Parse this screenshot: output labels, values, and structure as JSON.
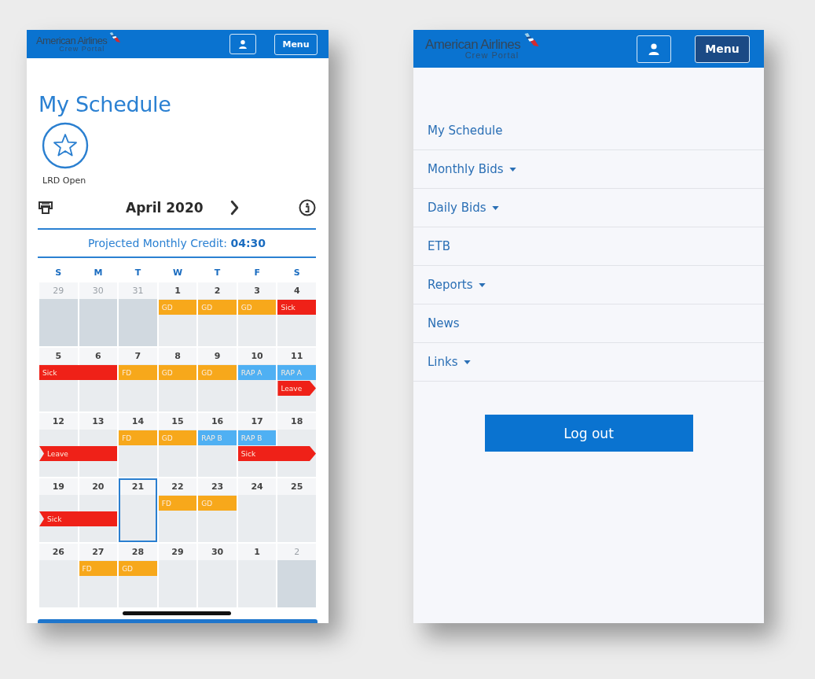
{
  "schedule_screen": {
    "header": {
      "logo_name": "American Airlines",
      "logo_subtitle": "Crew Portal",
      "menu_button": {
        "label": "Menu",
        "open": false
      }
    },
    "title": "My Schedule",
    "badge": {
      "label": "LRD Open"
    },
    "month": "April 2020",
    "credit": {
      "label": "Projected Monthly Credit:",
      "value": "04:30"
    },
    "weekdays": [
      "S",
      "M",
      "T",
      "W",
      "T",
      "F",
      "S"
    ],
    "weeks": [
      {
        "days": [
          {
            "label": "29",
            "outside": true,
            "selected": false
          },
          {
            "label": "30",
            "outside": true,
            "selected": false
          },
          {
            "label": "31",
            "outside": true,
            "selected": false
          },
          {
            "label": "1",
            "outside": false,
            "selected": false,
            "upper": {
              "kind": "start",
              "label": "GD",
              "color": "#f7a81b",
              "continues_before": false,
              "continues_after": false
            }
          },
          {
            "label": "2",
            "outside": false,
            "selected": false,
            "upper": {
              "kind": "start",
              "label": "GD",
              "color": "#f7a81b",
              "continues_before": false,
              "continues_after": false
            }
          },
          {
            "label": "3",
            "outside": false,
            "selected": false,
            "upper": {
              "kind": "start",
              "label": "GD",
              "color": "#f7a81b",
              "continues_before": false,
              "continues_after": false
            }
          },
          {
            "label": "4",
            "outside": false,
            "selected": false,
            "upper": {
              "kind": "start",
              "label": "Sick",
              "color": "#ef2118",
              "continues_before": false,
              "continues_after": false
            }
          }
        ]
      },
      {
        "days": [
          {
            "label": "5",
            "outside": false,
            "selected": false,
            "upper": {
              "kind": "start",
              "label": "Sick",
              "color": "#ef2118",
              "continues_before": false,
              "continues_after": false
            }
          },
          {
            "label": "6",
            "outside": false,
            "selected": false,
            "upper": {
              "kind": "continued"
            }
          },
          {
            "label": "7",
            "outside": false,
            "selected": false,
            "upper": {
              "kind": "start",
              "label": "FD",
              "color": "#f7a81b",
              "continues_before": false,
              "continues_after": false
            }
          },
          {
            "label": "8",
            "outside": false,
            "selected": false,
            "upper": {
              "kind": "start",
              "label": "GD",
              "color": "#f7a81b",
              "continues_before": false,
              "continues_after": false
            }
          },
          {
            "label": "9",
            "outside": false,
            "selected": false,
            "upper": {
              "kind": "start",
              "label": "GD",
              "color": "#f7a81b",
              "continues_before": false,
              "continues_after": false
            }
          },
          {
            "label": "10",
            "outside": false,
            "selected": false,
            "upper": {
              "kind": "start",
              "label": "RAP A",
              "color": "#4fb0f3",
              "continues_before": false,
              "continues_after": false
            }
          },
          {
            "label": "11",
            "outside": false,
            "selected": false,
            "upper": {
              "kind": "start",
              "label": "RAP A",
              "color": "#4fb0f3",
              "continues_before": false,
              "continues_after": false
            },
            "lower": {
              "kind": "start",
              "label": "Leave",
              "color": "#ef2118",
              "continues_before": false,
              "continues_after": true
            }
          }
        ]
      },
      {
        "days": [
          {
            "label": "12",
            "outside": false,
            "selected": false,
            "lower": {
              "kind": "start",
              "label": "Leave",
              "color": "#ef2118",
              "continues_before": true,
              "continues_after": false
            }
          },
          {
            "label": "13",
            "outside": false,
            "selected": false,
            "lower": {
              "kind": "continued"
            }
          },
          {
            "label": "14",
            "outside": false,
            "selected": false,
            "upper": {
              "kind": "start",
              "label": "FD",
              "color": "#f7a81b",
              "continues_before": false,
              "continues_after": false
            }
          },
          {
            "label": "15",
            "outside": false,
            "selected": false,
            "upper": {
              "kind": "start",
              "label": "GD",
              "color": "#f7a81b",
              "continues_before": false,
              "continues_after": false
            }
          },
          {
            "label": "16",
            "outside": false,
            "selected": false,
            "upper": {
              "kind": "start",
              "label": "RAP B",
              "color": "#4fb0f3",
              "continues_before": false,
              "continues_after": false
            }
          },
          {
            "label": "17",
            "outside": false,
            "selected": false,
            "upper": {
              "kind": "start",
              "label": "RAP B",
              "color": "#4fb0f3",
              "continues_before": false,
              "continues_after": false
            },
            "lower": {
              "kind": "start",
              "label": "Sick",
              "color": "#ef2118",
              "continues_before": false,
              "continues_after": true
            }
          },
          {
            "label": "18",
            "outside": false,
            "selected": false,
            "lower": {
              "kind": "continued"
            }
          }
        ]
      },
      {
        "days": [
          {
            "label": "19",
            "outside": false,
            "selected": false,
            "lower": {
              "kind": "start",
              "label": "Sick",
              "color": "#ef2118",
              "continues_before": true,
              "continues_after": false
            }
          },
          {
            "label": "20",
            "outside": false,
            "selected": false,
            "lower": {
              "kind": "continued"
            }
          },
          {
            "label": "21",
            "outside": false,
            "selected": true
          },
          {
            "label": "22",
            "outside": false,
            "selected": false,
            "upper": {
              "kind": "start",
              "label": "FD",
              "color": "#f7a81b",
              "continues_before": false,
              "continues_after": false
            }
          },
          {
            "label": "23",
            "outside": false,
            "selected": false,
            "upper": {
              "kind": "start",
              "label": "GD",
              "color": "#f7a81b",
              "continues_before": false,
              "continues_after": false
            }
          },
          {
            "label": "24",
            "outside": false,
            "selected": false
          },
          {
            "label": "25",
            "outside": false,
            "selected": false
          }
        ]
      },
      {
        "days": [
          {
            "label": "26",
            "outside": false,
            "selected": false
          },
          {
            "label": "27",
            "outside": false,
            "selected": false,
            "upper": {
              "kind": "start",
              "label": "FD",
              "color": "#f7a81b",
              "continues_before": false,
              "continues_after": false
            }
          },
          {
            "label": "28",
            "outside": false,
            "selected": false,
            "upper": {
              "kind": "start",
              "label": "GD",
              "color": "#f7a81b",
              "continues_before": false,
              "continues_after": false
            }
          },
          {
            "label": "29",
            "outside": false,
            "selected": false
          },
          {
            "label": "30",
            "outside": false,
            "selected": false
          },
          {
            "label": "1",
            "outside": false,
            "selected": false
          },
          {
            "label": "2",
            "outside": true,
            "selected": false
          }
        ]
      }
    ]
  },
  "menu_screen": {
    "header": {
      "logo_name": "American Airlines",
      "logo_subtitle": "Crew Portal",
      "menu_button": {
        "label": "Menu",
        "open": true
      }
    },
    "items": [
      {
        "label": "My Schedule",
        "has_submenu": false
      },
      {
        "label": "Monthly Bids",
        "has_submenu": true
      },
      {
        "label": "Daily Bids",
        "has_submenu": true
      },
      {
        "label": "ETB",
        "has_submenu": false
      },
      {
        "label": "Reports",
        "has_submenu": true
      },
      {
        "label": "News",
        "has_submenu": false
      },
      {
        "label": "Links",
        "has_submenu": true
      }
    ],
    "logout_button": "Log out"
  }
}
